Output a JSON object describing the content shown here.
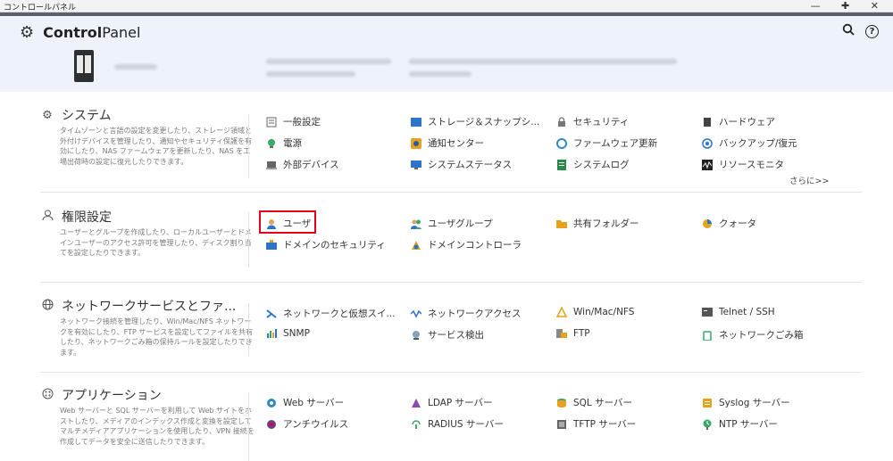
{
  "window": {
    "title": "コントロールパネル",
    "controls": "— ✚ ✕"
  },
  "header": {
    "brand_bold": "Control",
    "brand_light": "Panel",
    "search_icon": "search-icon",
    "help_icon": "help-icon"
  },
  "sections": {
    "system": {
      "title": "システム",
      "desc": "タイムゾーンと言語の設定を変更したり、ストレージ領域と外付けデバイスを管理したり、通知やセキュリティ保護を有効にしたり、NAS ファームウェアを更新したり、NAS を工場出荷時の設定に復元したりできます。",
      "items": [
        "一般設定",
        "ストレージ＆スナップシ...",
        "セキュリティ",
        "ハードウェア",
        "電源",
        "通知センター",
        "ファームウェア更新",
        "バックアップ/復元",
        "外部デバイス",
        "システムステータス",
        "システムログ",
        "リソースモニタ"
      ],
      "more": "さらに>>"
    },
    "privilege": {
      "title": "権限設定",
      "desc": "ユーザーとグループを作成したり、ローカルユーザーとドメインユーザーのアクセス許可を管理したり、ディスク割り当てを設定したりできます。",
      "items": [
        "ユーザ",
        "ユーザグループ",
        "共有フォルダー",
        "クォータ",
        "ドメインのセキュリティ",
        "ドメインコントローラ"
      ]
    },
    "network": {
      "title": "ネットワークサービスとファ...",
      "desc": "ネットワーク接続を管理したり、Win/Mac/NFS ネットワークを有効にしたり、FTP サービスを設定してファイルを共有したり、ネットワークごみ箱の保持ルールを設定したりできます。",
      "items": [
        "ネットワークと仮想スイ...",
        "ネットワークアクセス",
        "Win/Mac/NFS",
        "Telnet / SSH",
        "SNMP",
        "サービス検出",
        "FTP",
        "ネットワークごみ箱"
      ]
    },
    "apps": {
      "title": "アプリケーション",
      "desc": "Web サーバーと SQL サーバーを利用して Web サイトをホストしたり、メディアのインデックス作成と変換を設定してマルチメディアアプリケーションを使用したり、VPN 接続を作成してデータを安全に送信したりできます。",
      "items": [
        "Web サーバー",
        "LDAP サーバー",
        "SQL サーバー",
        "Syslog サーバー",
        "アンチウイルス",
        "RADIUS サーバー",
        "TFTP サーバー",
        "NTP サーバー"
      ]
    }
  }
}
